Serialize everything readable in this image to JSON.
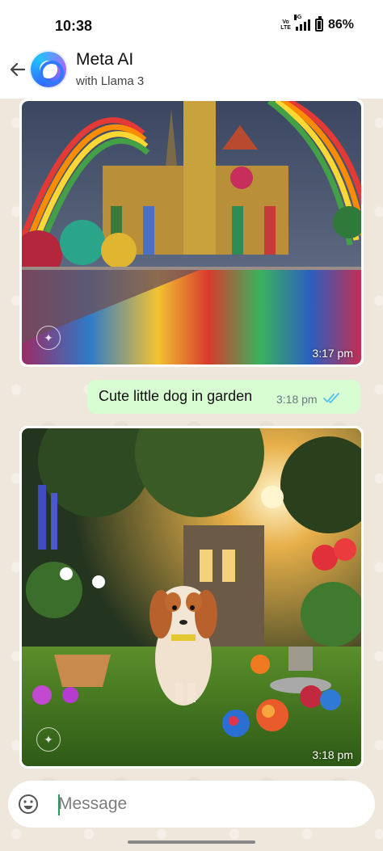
{
  "status_bar": {
    "time": "10:38",
    "network_label_1": "Vo",
    "network_label_2": "LTE",
    "network_5g": "5G",
    "battery_text": "86%"
  },
  "header": {
    "title": "Meta AI",
    "subtitle": "with Llama 3",
    "back_icon": "arrow-left-icon",
    "avatar_icon": "meta-ai-ring-icon"
  },
  "messages": [
    {
      "type": "image",
      "sender": "meta-ai",
      "time": "3:17 pm",
      "icon": "ai-sparkle-icon"
    },
    {
      "type": "text",
      "sender": "me",
      "text": "Cute little dog in garden",
      "time": "3:18 pm",
      "status_icon": "double-check-icon"
    },
    {
      "type": "image",
      "sender": "meta-ai",
      "time": "3:18 pm",
      "icon": "ai-sparkle-icon"
    }
  ],
  "composer": {
    "placeholder": "Message",
    "emoji_icon": "emoji-icon"
  },
  "colors": {
    "chat_background": "#efe7dc",
    "outgoing_bubble": "#d9fdd3",
    "read_tick": "#53bdeb"
  }
}
